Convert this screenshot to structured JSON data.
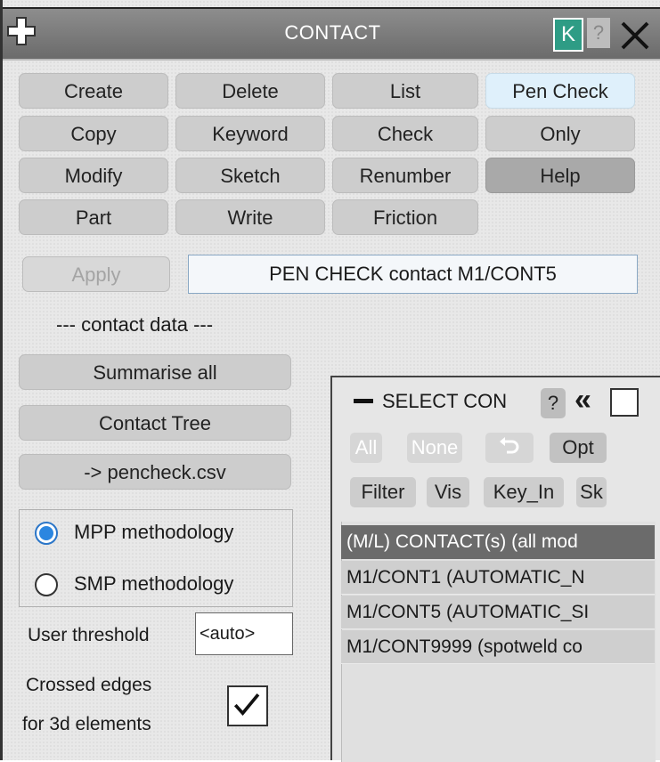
{
  "titlebar": {
    "title": "CONTACT",
    "k_label": "K",
    "help_label": "?"
  },
  "buttons": {
    "create": "Create",
    "delete": "Delete",
    "list": "List",
    "pen_check": "Pen Check",
    "copy": "Copy",
    "keyword": "Keyword",
    "check": "Check",
    "only": "Only",
    "modify": "Modify",
    "sketch": "Sketch",
    "renumber": "Renumber",
    "help": "Help",
    "part": "Part",
    "write": "Write",
    "friction": "Friction"
  },
  "apply": {
    "label": "Apply",
    "command": "PEN CHECK contact M1/CONT5"
  },
  "contact_data": {
    "header": "--- contact data ---",
    "summarise": "Summarise all",
    "tree": "Contact Tree",
    "csv": "-> pencheck.csv"
  },
  "methodology": {
    "options": [
      "MPP methodology",
      "SMP methodology"
    ],
    "selected": "MPP methodology"
  },
  "threshold": {
    "label": "User threshold",
    "value": "<auto>"
  },
  "crossed": {
    "line1": "Crossed edges",
    "line2": "for 3d elements",
    "checked": true
  },
  "select_panel": {
    "title": "SELECT CON",
    "help": "?",
    "collapse": "«",
    "all": "All",
    "none": "None",
    "opt": "Opt",
    "filter": "Filter",
    "vis": "Vis",
    "key_in": "Key_In",
    "sk": "Sk",
    "list_header": "(M/L) CONTACT(s) (all mod",
    "items": [
      "M1/CONT1 (AUTOMATIC_N",
      "M1/CONT5 (AUTOMATIC_SI",
      "M1/CONT9999 (spotweld co"
    ]
  },
  "colors": {
    "titlebar": "#7a7a8a",
    "k_button": "#2e9c85",
    "selected_radio": "#2b86e0",
    "pen_check_bg": "#dff0fb"
  }
}
